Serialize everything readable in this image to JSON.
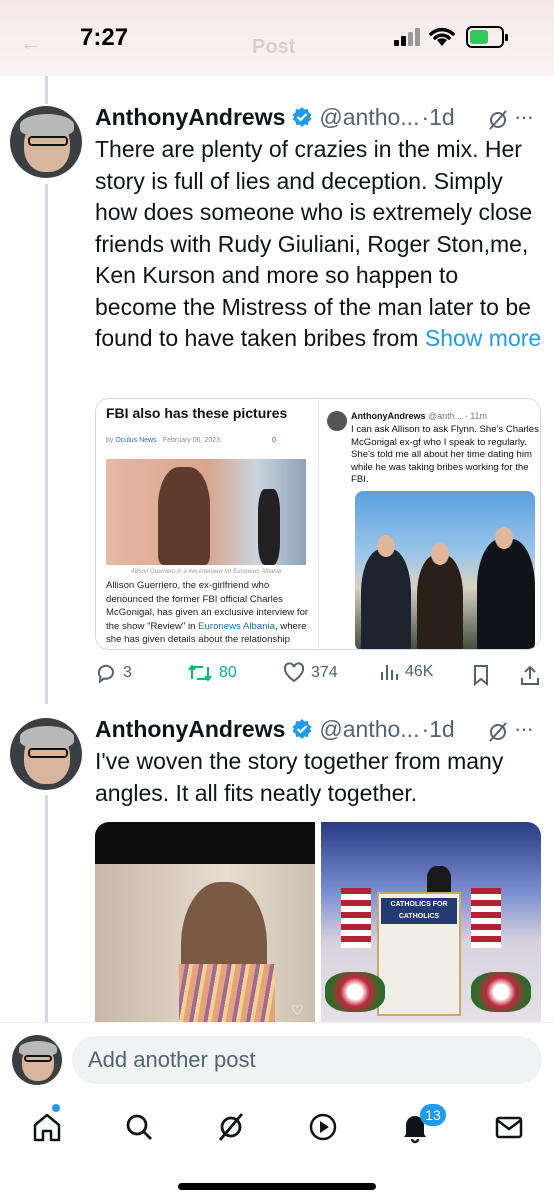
{
  "status_bar": {
    "time": "7:27"
  },
  "header": {
    "title": "Post"
  },
  "posts": [
    {
      "name": "AnthonyAndrews",
      "handle": "@antho...",
      "time": "1d",
      "text": "There are plenty of crazies in the mix. Her story is full of lies and deception. Simply how does someone who is extremely close friends with Rudy Giuliani, Roger Ston,me, Ken Kurson and more so happen to become the Mistress of the man later to be found to have taken bribes from",
      "show_more": "Show more",
      "media": {
        "left": {
          "title": "FBI also has these pictures",
          "byline": "by",
          "source": "Oculus News",
          "date": "February 06, 2023",
          "comments": "0",
          "caption": "Allison Guerriero in a live interview for Euronews Albania",
          "body_1": "Allison Guerriero, the ex-girlfriend who denounced the former FBI official Charles McGonigal, has given an exclusive interview for the show \"Review\" in ",
          "body_link": "Euronews Albania",
          "body_2": ", where she has given details about the relationship"
        },
        "right": {
          "name": "AnthonyAndrews",
          "handle": "@anth...",
          "time": "11m",
          "text": "I can ask Allison to ask Flynn. She's Charles McGonigal ex-gf who I speak to regularly. She's told me all about her time dating him while he was taking bribes working for the FBI."
        }
      },
      "stats": {
        "replies": "3",
        "reposts": "80",
        "likes": "374",
        "views": "46K"
      }
    },
    {
      "name": "AnthonyAndrews",
      "handle": "@antho...",
      "time": "1d",
      "text": "I've woven the story together from many angles. It all fits neatly together.",
      "podium_sign": "CATHOLICS FOR CATHOLICS"
    }
  ],
  "compose": {
    "placeholder": "Add another post"
  },
  "tabbar": {
    "notifications_badge": "13"
  },
  "colors": {
    "accent": "#1d9bf0",
    "repost": "#00ba7c",
    "muted": "#536471"
  },
  "icons": [
    "home-icon",
    "search-icon",
    "grok-icon",
    "video-icon",
    "bell-icon",
    "mail-icon",
    "reply-icon",
    "repost-icon",
    "like-icon",
    "views-icon",
    "bookmark-icon",
    "share-icon",
    "verified-icon",
    "more-icon"
  ]
}
